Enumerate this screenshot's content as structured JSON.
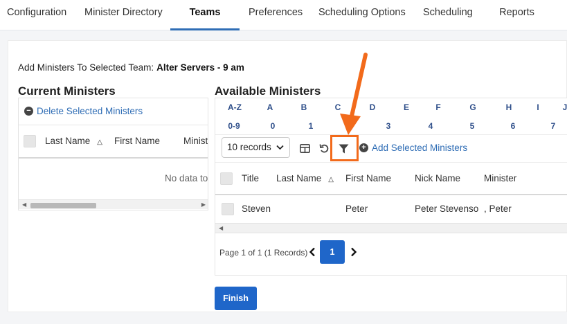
{
  "nav": {
    "tabs": [
      {
        "label": "Configuration"
      },
      {
        "label": "Minister Directory"
      },
      {
        "label": "Teams"
      },
      {
        "label": "Preferences"
      },
      {
        "label": "Scheduling Options"
      },
      {
        "label": "Scheduling"
      },
      {
        "label": "Reports"
      }
    ],
    "active": "Teams"
  },
  "selected_team": {
    "label": "Add Ministers To Selected Team:",
    "name": "Alter Servers - 9 am"
  },
  "current": {
    "title": "Current Ministers",
    "delete_label": "Delete Selected Ministers",
    "columns": [
      "Last Name",
      "First Name",
      "Minist"
    ],
    "empty_text": "No data to"
  },
  "available": {
    "title": "Available Ministers",
    "letters_row1": [
      "A-Z",
      "A",
      "B",
      "C",
      "D",
      "E",
      "F",
      "G",
      "H",
      "I",
      "J"
    ],
    "letters_row2": [
      "0-9",
      "0",
      "1",
      "2",
      "3",
      "4",
      "5",
      "6",
      "7"
    ],
    "records_select": "10 records",
    "add_label": "Add Selected Ministers",
    "columns": [
      "Title",
      "Last Name",
      "First Name",
      "Nick Name",
      "Minister"
    ],
    "rows": [
      {
        "title": "Steven",
        "last_name": "",
        "first_name": "Peter",
        "nick_name": "Peter Stevenso",
        "minister": ", Peter"
      }
    ],
    "pager_text": "Page 1 of 1 (1 Records)",
    "current_page": "1"
  },
  "finish_label": "Finish",
  "icons": {
    "delete": "minus-circle-icon",
    "sort": "sort-asc-icon",
    "grid": "column-chooser-icon",
    "reset": "undo-icon",
    "filter": "filter-icon",
    "add": "plus-circle-icon",
    "prev": "chevron-left-icon",
    "next": "chevron-right-icon"
  },
  "colors": {
    "accent": "#1f66c9",
    "link": "#2f6db5",
    "annotation": "#f26a1b"
  }
}
